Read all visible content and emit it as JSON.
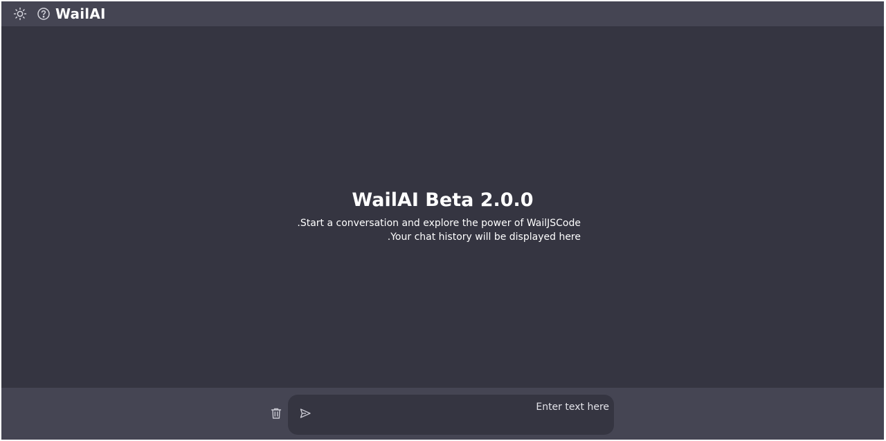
{
  "header": {
    "brand": "WailAI",
    "theme_toggle_icon": "sun-icon",
    "help_icon": "help-circle-icon"
  },
  "hero": {
    "title": "WailAI Beta 2.0.0",
    "line1": ".Start a conversation and explore the power of WailJSCode",
    "line2": ".Your chat history will be displayed here"
  },
  "composer": {
    "placeholder": "Enter text here",
    "value": "",
    "clear_icon": "trash-icon",
    "send_icon": "send-icon"
  },
  "colors": {
    "background": "#353541",
    "bar": "#454553",
    "text": "#ffffff"
  }
}
